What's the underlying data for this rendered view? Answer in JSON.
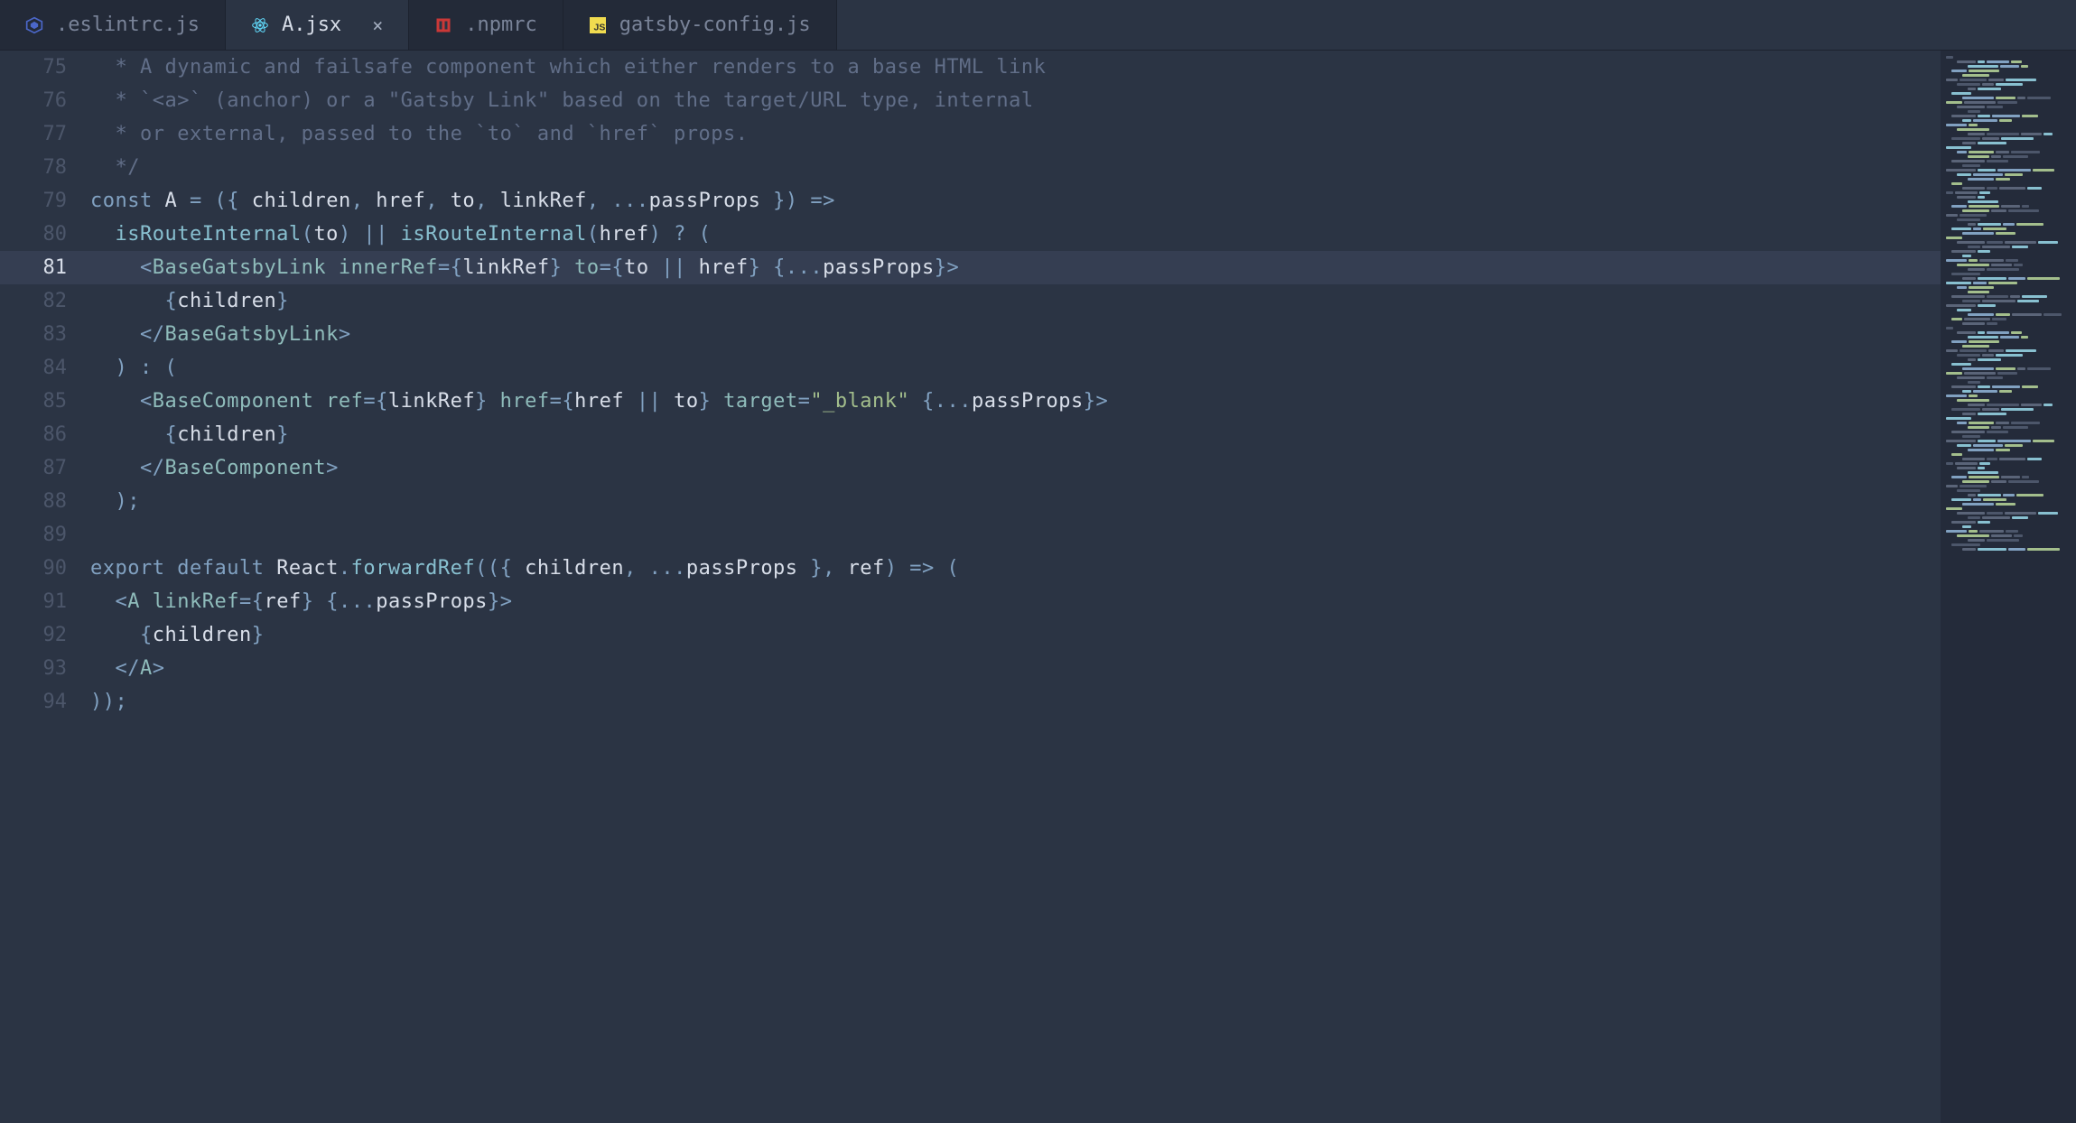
{
  "tabs": [
    {
      "label": ".eslintrc.js",
      "icon": "eslint",
      "active": false
    },
    {
      "label": "A.jsx",
      "icon": "react",
      "active": true
    },
    {
      "label": ".npmrc",
      "icon": "npm",
      "active": false
    },
    {
      "label": "gatsby-config.js",
      "icon": "js",
      "active": false
    }
  ],
  "close_glyph": "×",
  "lines": [
    {
      "num": "75",
      "hl": false,
      "tokens": [
        {
          "t": "  * A dynamic and failsafe component which either renders to a base HTML link",
          "c": "c-comment"
        }
      ]
    },
    {
      "num": "76",
      "hl": false,
      "tokens": [
        {
          "t": "  * `<a>` (anchor) or a \"Gatsby Link\" based on the target/URL type, internal",
          "c": "c-comment"
        }
      ]
    },
    {
      "num": "77",
      "hl": false,
      "tokens": [
        {
          "t": "  * or external, passed to the `to` and `href` props.",
          "c": "c-comment"
        }
      ]
    },
    {
      "num": "78",
      "hl": false,
      "tokens": [
        {
          "t": "  */",
          "c": "c-comment"
        }
      ]
    },
    {
      "num": "79",
      "hl": false,
      "tokens": [
        {
          "t": "const ",
          "c": "c-kw"
        },
        {
          "t": "A",
          "c": "c-ident"
        },
        {
          "t": " = ",
          "c": "c-op"
        },
        {
          "t": "(",
          "c": "c-punc"
        },
        {
          "t": "{ ",
          "c": "c-brace"
        },
        {
          "t": "children",
          "c": "c-ident"
        },
        {
          "t": ", ",
          "c": "c-punc"
        },
        {
          "t": "href",
          "c": "c-ident"
        },
        {
          "t": ", ",
          "c": "c-punc"
        },
        {
          "t": "to",
          "c": "c-ident"
        },
        {
          "t": ", ",
          "c": "c-punc"
        },
        {
          "t": "linkRef",
          "c": "c-ident"
        },
        {
          "t": ", ",
          "c": "c-punc"
        },
        {
          "t": "...",
          "c": "c-op"
        },
        {
          "t": "passProps",
          "c": "c-ident"
        },
        {
          "t": " }",
          "c": "c-brace"
        },
        {
          "t": ")",
          "c": "c-punc"
        },
        {
          "t": " =>",
          "c": "c-op"
        }
      ]
    },
    {
      "num": "80",
      "hl": false,
      "tokens": [
        {
          "t": "  ",
          "c": ""
        },
        {
          "t": "isRouteInternal",
          "c": "c-fn"
        },
        {
          "t": "(",
          "c": "c-punc"
        },
        {
          "t": "to",
          "c": "c-ident"
        },
        {
          "t": ")",
          "c": "c-punc"
        },
        {
          "t": " || ",
          "c": "c-op"
        },
        {
          "t": "isRouteInternal",
          "c": "c-fn"
        },
        {
          "t": "(",
          "c": "c-punc"
        },
        {
          "t": "href",
          "c": "c-ident"
        },
        {
          "t": ")",
          "c": "c-punc"
        },
        {
          "t": " ? ",
          "c": "c-op"
        },
        {
          "t": "(",
          "c": "c-punc"
        }
      ]
    },
    {
      "num": "81",
      "hl": true,
      "tokens": [
        {
          "t": "    ",
          "c": ""
        },
        {
          "t": "<",
          "c": "c-punc"
        },
        {
          "t": "BaseGatsbyLink",
          "c": "c-tag"
        },
        {
          "t": " ",
          "c": ""
        },
        {
          "t": "innerRef",
          "c": "c-attr"
        },
        {
          "t": "=",
          "c": "c-op"
        },
        {
          "t": "{",
          "c": "c-brace"
        },
        {
          "t": "linkRef",
          "c": "c-attrval"
        },
        {
          "t": "}",
          "c": "c-brace"
        },
        {
          "t": " ",
          "c": ""
        },
        {
          "t": "to",
          "c": "c-attr"
        },
        {
          "t": "=",
          "c": "c-op"
        },
        {
          "t": "{",
          "c": "c-brace"
        },
        {
          "t": "to",
          "c": "c-attrval"
        },
        {
          "t": " || ",
          "c": "c-op"
        },
        {
          "t": "href",
          "c": "c-attrval"
        },
        {
          "t": "}",
          "c": "c-brace"
        },
        {
          "t": " ",
          "c": ""
        },
        {
          "t": "{",
          "c": "c-brace"
        },
        {
          "t": "...",
          "c": "c-op"
        },
        {
          "t": "passProps",
          "c": "c-attrval"
        },
        {
          "t": "}",
          "c": "c-brace"
        },
        {
          "t": ">",
          "c": "c-punc"
        }
      ]
    },
    {
      "num": "82",
      "hl": false,
      "tokens": [
        {
          "t": "      ",
          "c": ""
        },
        {
          "t": "{",
          "c": "c-brace"
        },
        {
          "t": "children",
          "c": "c-ident"
        },
        {
          "t": "}",
          "c": "c-brace"
        }
      ]
    },
    {
      "num": "83",
      "hl": false,
      "tokens": [
        {
          "t": "    ",
          "c": ""
        },
        {
          "t": "</",
          "c": "c-punc"
        },
        {
          "t": "BaseGatsbyLink",
          "c": "c-tag"
        },
        {
          "t": ">",
          "c": "c-punc"
        }
      ]
    },
    {
      "num": "84",
      "hl": false,
      "tokens": [
        {
          "t": "  ",
          "c": ""
        },
        {
          "t": ")",
          "c": "c-punc"
        },
        {
          "t": " : ",
          "c": "c-op"
        },
        {
          "t": "(",
          "c": "c-punc"
        }
      ]
    },
    {
      "num": "85",
      "hl": false,
      "tokens": [
        {
          "t": "    ",
          "c": ""
        },
        {
          "t": "<",
          "c": "c-punc"
        },
        {
          "t": "BaseComponent",
          "c": "c-tag"
        },
        {
          "t": " ",
          "c": ""
        },
        {
          "t": "ref",
          "c": "c-attr"
        },
        {
          "t": "=",
          "c": "c-op"
        },
        {
          "t": "{",
          "c": "c-brace"
        },
        {
          "t": "linkRef",
          "c": "c-attrval"
        },
        {
          "t": "}",
          "c": "c-brace"
        },
        {
          "t": " ",
          "c": ""
        },
        {
          "t": "href",
          "c": "c-attr"
        },
        {
          "t": "=",
          "c": "c-op"
        },
        {
          "t": "{",
          "c": "c-brace"
        },
        {
          "t": "href",
          "c": "c-attrval"
        },
        {
          "t": " || ",
          "c": "c-op"
        },
        {
          "t": "to",
          "c": "c-attrval"
        },
        {
          "t": "}",
          "c": "c-brace"
        },
        {
          "t": " ",
          "c": ""
        },
        {
          "t": "target",
          "c": "c-attr"
        },
        {
          "t": "=",
          "c": "c-op"
        },
        {
          "t": "\"_blank\"",
          "c": "c-str"
        },
        {
          "t": " ",
          "c": ""
        },
        {
          "t": "{",
          "c": "c-brace"
        },
        {
          "t": "...",
          "c": "c-op"
        },
        {
          "t": "passProps",
          "c": "c-attrval"
        },
        {
          "t": "}",
          "c": "c-brace"
        },
        {
          "t": ">",
          "c": "c-punc"
        }
      ]
    },
    {
      "num": "86",
      "hl": false,
      "tokens": [
        {
          "t": "      ",
          "c": ""
        },
        {
          "t": "{",
          "c": "c-brace"
        },
        {
          "t": "children",
          "c": "c-ident"
        },
        {
          "t": "}",
          "c": "c-brace"
        }
      ]
    },
    {
      "num": "87",
      "hl": false,
      "tokens": [
        {
          "t": "    ",
          "c": ""
        },
        {
          "t": "</",
          "c": "c-punc"
        },
        {
          "t": "BaseComponent",
          "c": "c-tag"
        },
        {
          "t": ">",
          "c": "c-punc"
        }
      ]
    },
    {
      "num": "88",
      "hl": false,
      "tokens": [
        {
          "t": "  ",
          "c": ""
        },
        {
          "t": ")",
          "c": "c-punc"
        },
        {
          "t": ";",
          "c": "c-punc"
        }
      ]
    },
    {
      "num": "89",
      "hl": false,
      "tokens": []
    },
    {
      "num": "90",
      "hl": false,
      "tokens": [
        {
          "t": "export default ",
          "c": "c-kw"
        },
        {
          "t": "React",
          "c": "c-ident"
        },
        {
          "t": ".",
          "c": "c-punc"
        },
        {
          "t": "forwardRef",
          "c": "c-fn"
        },
        {
          "t": "((",
          "c": "c-punc"
        },
        {
          "t": "{ ",
          "c": "c-brace"
        },
        {
          "t": "children",
          "c": "c-ident"
        },
        {
          "t": ", ",
          "c": "c-punc"
        },
        {
          "t": "...",
          "c": "c-op"
        },
        {
          "t": "passProps",
          "c": "c-ident"
        },
        {
          "t": " }",
          "c": "c-brace"
        },
        {
          "t": ", ",
          "c": "c-punc"
        },
        {
          "t": "ref",
          "c": "c-ident"
        },
        {
          "t": ")",
          "c": "c-punc"
        },
        {
          "t": " => ",
          "c": "c-op"
        },
        {
          "t": "(",
          "c": "c-punc"
        }
      ]
    },
    {
      "num": "91",
      "hl": false,
      "tokens": [
        {
          "t": "  ",
          "c": ""
        },
        {
          "t": "<",
          "c": "c-punc"
        },
        {
          "t": "A",
          "c": "c-tag"
        },
        {
          "t": " ",
          "c": ""
        },
        {
          "t": "linkRef",
          "c": "c-attr"
        },
        {
          "t": "=",
          "c": "c-op"
        },
        {
          "t": "{",
          "c": "c-brace"
        },
        {
          "t": "ref",
          "c": "c-attrval"
        },
        {
          "t": "}",
          "c": "c-brace"
        },
        {
          "t": " ",
          "c": ""
        },
        {
          "t": "{",
          "c": "c-brace"
        },
        {
          "t": "...",
          "c": "c-op"
        },
        {
          "t": "passProps",
          "c": "c-attrval"
        },
        {
          "t": "}",
          "c": "c-brace"
        },
        {
          "t": ">",
          "c": "c-punc"
        }
      ]
    },
    {
      "num": "92",
      "hl": false,
      "tokens": [
        {
          "t": "    ",
          "c": ""
        },
        {
          "t": "{",
          "c": "c-brace"
        },
        {
          "t": "children",
          "c": "c-ident"
        },
        {
          "t": "}",
          "c": "c-brace"
        }
      ]
    },
    {
      "num": "93",
      "hl": false,
      "tokens": [
        {
          "t": "  ",
          "c": ""
        },
        {
          "t": "</",
          "c": "c-punc"
        },
        {
          "t": "A",
          "c": "c-tag"
        },
        {
          "t": ">",
          "c": "c-punc"
        }
      ]
    },
    {
      "num": "94",
      "hl": false,
      "tokens": [
        {
          "t": "))",
          "c": "c-punc"
        },
        {
          "t": ";",
          "c": "c-punc"
        }
      ]
    }
  ]
}
